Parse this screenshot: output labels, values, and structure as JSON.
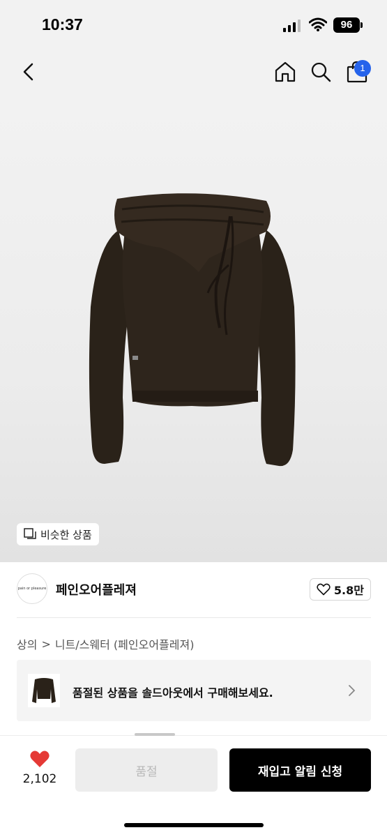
{
  "status_bar": {
    "time": "10:37",
    "battery": "96"
  },
  "nav": {
    "cart_count": "1"
  },
  "product": {
    "similar_label": "비슷한 상품"
  },
  "brand": {
    "logo_text": "pain or pleasure",
    "name": "페인오어플레져",
    "likes": "5.8만"
  },
  "breadcrumb": {
    "category": "상의",
    "separator": ">",
    "subcategory": "니트/스웨터 (페인오어플레져)"
  },
  "banner": {
    "text": "품절된 상품을 솔드아웃에서 구매해보세요."
  },
  "bottom_bar": {
    "wish_count": "2,102",
    "soldout_label": "품절",
    "restock_label": "재입고 알림 신청"
  },
  "colors": {
    "accent": "#2563eb",
    "heart": "#e53935",
    "product": "#2a2219"
  }
}
